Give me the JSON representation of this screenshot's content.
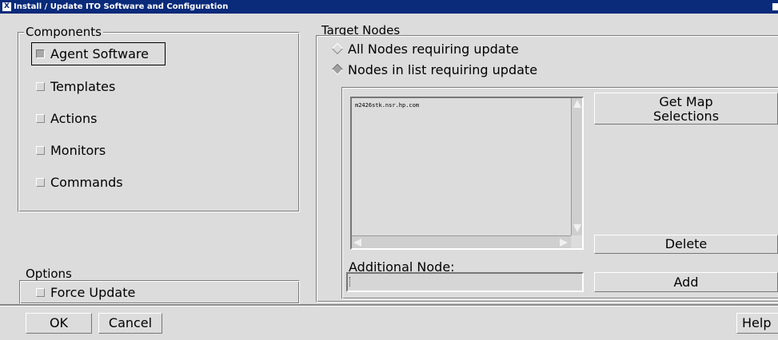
{
  "window": {
    "title": "Install / Update ITO Software and Configuration",
    "icon": "x-window-icon"
  },
  "components": {
    "label": "Components",
    "items": [
      {
        "label": "Agent Software",
        "checked": true
      },
      {
        "label": "Templates",
        "checked": false
      },
      {
        "label": "Actions",
        "checked": false
      },
      {
        "label": "Monitors",
        "checked": false
      },
      {
        "label": "Commands",
        "checked": false
      }
    ]
  },
  "options": {
    "label": "Options",
    "force_update": {
      "label": "Force Update",
      "checked": false
    }
  },
  "target": {
    "label": "Target Nodes",
    "radio_all": {
      "label": "All Nodes requiring update",
      "selected": false
    },
    "radio_list": {
      "label": "Nodes in list requiring update",
      "selected": true
    },
    "nodes": [
      "m2426stk.nsr.hp.com"
    ],
    "get_map_line1": "Get Map",
    "get_map_line2": "Selections",
    "delete_label": "Delete",
    "additional_label": "Additional Node:",
    "additional_value": "",
    "add_label": "Add"
  },
  "footer": {
    "ok": "OK",
    "cancel": "Cancel",
    "help": "Help"
  }
}
